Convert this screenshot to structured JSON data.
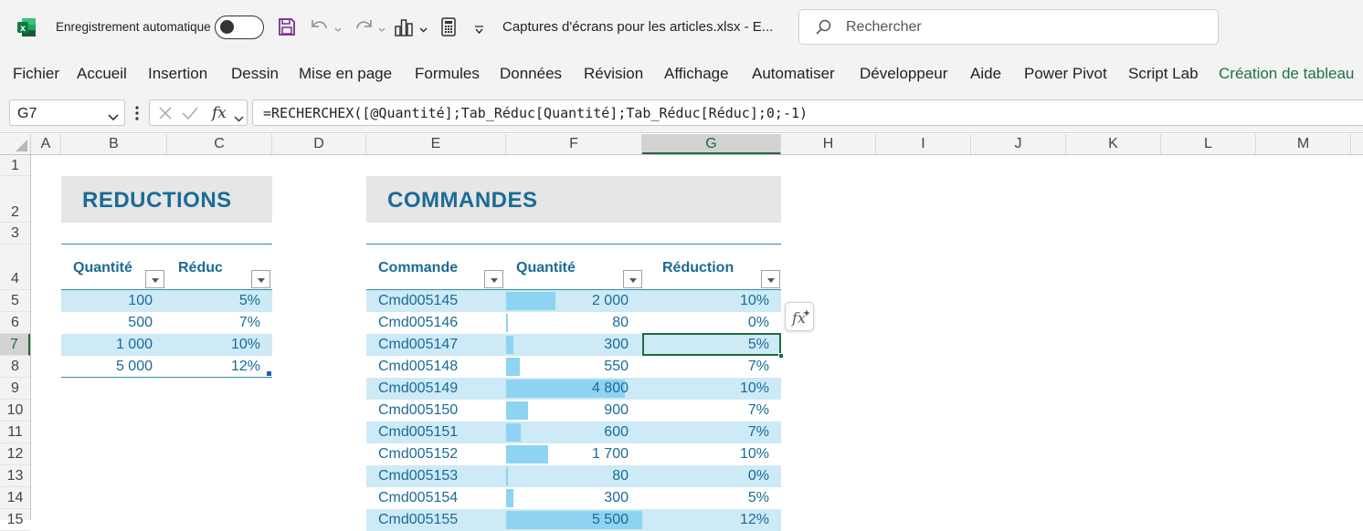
{
  "titlebar": {
    "autosave_label": "Enregistrement automatique",
    "file_title": "Captures d'écrans pour les articles.xlsx  -  E...",
    "search_placeholder": "Rechercher"
  },
  "ribbon": {
    "tabs": [
      "Fichier",
      "Accueil",
      "Insertion",
      "Dessin",
      "Mise en page",
      "Formules",
      "Données",
      "Révision",
      "Affichage",
      "Automatiser",
      "Développeur",
      "Aide",
      "Power Pivot",
      "Script Lab",
      "Création de tableau"
    ],
    "active_color": "#1e7145"
  },
  "formula_bar": {
    "name_box": "G7",
    "formula": "=RECHERCHEX([@Quantité];Tab_Réduc[Quantité];Tab_Réduc[Réduc];0;-1)"
  },
  "columns": [
    "A",
    "B",
    "C",
    "D",
    "E",
    "F",
    "G",
    "H",
    "I",
    "J",
    "K",
    "L",
    "M"
  ],
  "rows": [
    "1",
    "2",
    "3",
    "4",
    "5",
    "6",
    "7",
    "8",
    "9",
    "10",
    "11",
    "12",
    "13",
    "14",
    "15"
  ],
  "selected_cell": {
    "column": "G",
    "row": "7"
  },
  "reductions": {
    "title": "REDUCTIONS",
    "headers": [
      "Quantité",
      "Réduc"
    ],
    "rows": [
      {
        "qty": "100",
        "reduc": "5%"
      },
      {
        "qty": "500",
        "reduc": "7%"
      },
      {
        "qty": "1 000",
        "reduc": "10%"
      },
      {
        "qty": "5 000",
        "reduc": "12%"
      }
    ]
  },
  "commandes": {
    "title": "COMMANDES",
    "headers": [
      "Commande",
      "Quantité",
      "Réduction"
    ],
    "bar_max": 5500,
    "rows": [
      {
        "cmd": "Cmd005145",
        "qty": "2 000",
        "qty_value": 2000,
        "red": "10%"
      },
      {
        "cmd": "Cmd005146",
        "qty": "80",
        "qty_value": 80,
        "red": "0%"
      },
      {
        "cmd": "Cmd005147",
        "qty": "300",
        "qty_value": 300,
        "red": "5%"
      },
      {
        "cmd": "Cmd005148",
        "qty": "550",
        "qty_value": 550,
        "red": "7%"
      },
      {
        "cmd": "Cmd005149",
        "qty": "4 800",
        "qty_value": 4800,
        "red": "10%"
      },
      {
        "cmd": "Cmd005150",
        "qty": "900",
        "qty_value": 900,
        "red": "7%"
      },
      {
        "cmd": "Cmd005151",
        "qty": "600",
        "qty_value": 600,
        "red": "7%"
      },
      {
        "cmd": "Cmd005152",
        "qty": "1 700",
        "qty_value": 1700,
        "red": "10%"
      },
      {
        "cmd": "Cmd005153",
        "qty": "80",
        "qty_value": 80,
        "red": "0%"
      },
      {
        "cmd": "Cmd005154",
        "qty": "300",
        "qty_value": 300,
        "red": "5%"
      },
      {
        "cmd": "Cmd005155",
        "qty": "5 500",
        "qty_value": 5500,
        "red": "12%"
      }
    ]
  },
  "colors": {
    "band_row": "#cdeaf6",
    "data_bar": "#8fd3f2",
    "table_text": "#1a6b96",
    "selection": "#1e6b3c"
  }
}
